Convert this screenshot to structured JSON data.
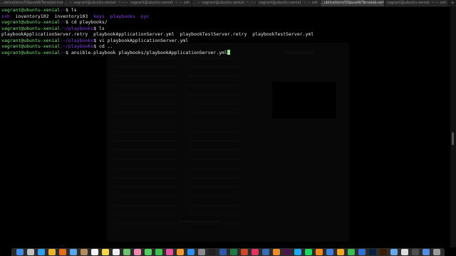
{
  "tabs": [
    {
      "label": "...ublications/OSJavaW/Tarsolab-tools2 — vagrant@ubuntu-xenial: ~ — ssh",
      "active": false
    },
    {
      "label": "... — vagrant@ubuntu-xenial: ~ — ssh",
      "active": false
    },
    {
      "label": "vagrant@ubuntu-xenial: ~ — ssh",
      "active": false
    },
    {
      "label": "... — vagrant@ubuntu-xenial: ~ — ssh",
      "active": false
    },
    {
      "label": "vagrant@ubuntu-xenial: ~ — ssh",
      "active": false
    },
    {
      "label": "...ublications/OSJavaW/Tarsolab-service — vagrant@ubuntu-xenial: ~ — ssh",
      "active": true
    },
    {
      "label": "vagrant@ubuntu-xenial: ~ — ssh",
      "active": false
    }
  ],
  "terminal": {
    "prompt_user": "vagrant@ubuntu-xenial",
    "line1_path": ":~",
    "line1_cmd": "$ ls",
    "line2": {
      "item1": "ssh",
      "item2": "inventory102",
      "item3": "inventory103",
      "item4": "keys",
      "item5": "playbooks",
      "item6": "pyc"
    },
    "line3_path": ":~",
    "line3_cmd": "$ cd playbooks/",
    "line4_path": ":~/playbooks",
    "line4_cmd": "$ ls",
    "line5": "playbookApplicationServer.retry  playbookApplicationServer.yml  playbookTestServer.retry  playbookTestServer.yml",
    "line6_path": ":~/playbooks",
    "line6_cmd": "$ vi playbookApplicationServer.yml",
    "line7_path": ":~/playbooks",
    "line7_cmd": "$ cd ..",
    "line8_path": ":~",
    "line8_cmd": "$ ansible-playbook playbooks/playbookApplicationServer.yml"
  },
  "colors": {
    "prompt_user": "#7fe07f",
    "prompt_path": "#8a3cf2",
    "directory": "#8a3cf2",
    "text": "#e8e8e8"
  },
  "dock_icons": [
    {
      "name": "finder-icon",
      "color": "#3d8ee8"
    },
    {
      "name": "launchpad-icon",
      "color": "#c0c0c0"
    },
    {
      "name": "safari-icon",
      "color": "#2e9ef0"
    },
    {
      "name": "chrome-icon",
      "color": "#e9b52d"
    },
    {
      "name": "firefox-icon",
      "color": "#e66a1f"
    },
    {
      "name": "mail-icon",
      "color": "#5aa7ee"
    },
    {
      "name": "contacts-icon",
      "color": "#b48a5a"
    },
    {
      "name": "calendar-icon",
      "color": "#f4f4f4"
    },
    {
      "name": "notes-icon",
      "color": "#f6d64a"
    },
    {
      "name": "reminders-icon",
      "color": "#eeeeee"
    },
    {
      "name": "maps-icon",
      "color": "#6cc56c"
    },
    {
      "name": "photos-icon",
      "color": "#f08ab0"
    },
    {
      "name": "messages-icon",
      "color": "#4fd15c"
    },
    {
      "name": "facetime-icon",
      "color": "#3fbf4f"
    },
    {
      "name": "itunes-icon",
      "color": "#e850a0"
    },
    {
      "name": "ibooks-icon",
      "color": "#f29a2e"
    },
    {
      "name": "app-store-icon",
      "color": "#2e8ef0"
    },
    {
      "name": "system-preferences-icon",
      "color": "#8a8a8a"
    },
    {
      "name": "terminal-icon",
      "color": "#222222"
    },
    {
      "name": "word-icon",
      "color": "#2b5ba8"
    },
    {
      "name": "excel-icon",
      "color": "#1f7a45"
    },
    {
      "name": "powerpoint-icon",
      "color": "#c94a25"
    },
    {
      "name": "intellij-icon",
      "color": "#e3335f"
    },
    {
      "name": "virtualbox-icon",
      "color": "#3a6ab8"
    },
    {
      "name": "sublime-icon",
      "color": "#ef8a2a"
    },
    {
      "name": "slack-icon",
      "color": "#4a154b"
    },
    {
      "name": "skype-icon",
      "color": "#1ba8ee"
    },
    {
      "name": "spotify-icon",
      "color": "#1ed760"
    },
    {
      "name": "vlc-icon",
      "color": "#f08a1c"
    },
    {
      "name": "keynote-icon",
      "color": "#3c7fdf"
    },
    {
      "name": "pages-icon",
      "color": "#f5a623"
    },
    {
      "name": "numbers-icon",
      "color": "#3cba54"
    },
    {
      "name": "xcode-icon",
      "color": "#2f6fd6"
    },
    {
      "name": "photoshop-icon",
      "color": "#0a1e3d"
    },
    {
      "name": "illustrator-icon",
      "color": "#3b1b00"
    },
    {
      "name": "preview-icon",
      "color": "#6aa9e8"
    },
    {
      "name": "textedit-icon",
      "color": "#dddddd"
    },
    {
      "name": "activity-monitor-icon",
      "color": "#4d4d4d"
    },
    {
      "name": "downloads-icon",
      "color": "#4f8ee0"
    },
    {
      "name": "trash-icon",
      "color": "#9a9a9a"
    }
  ]
}
